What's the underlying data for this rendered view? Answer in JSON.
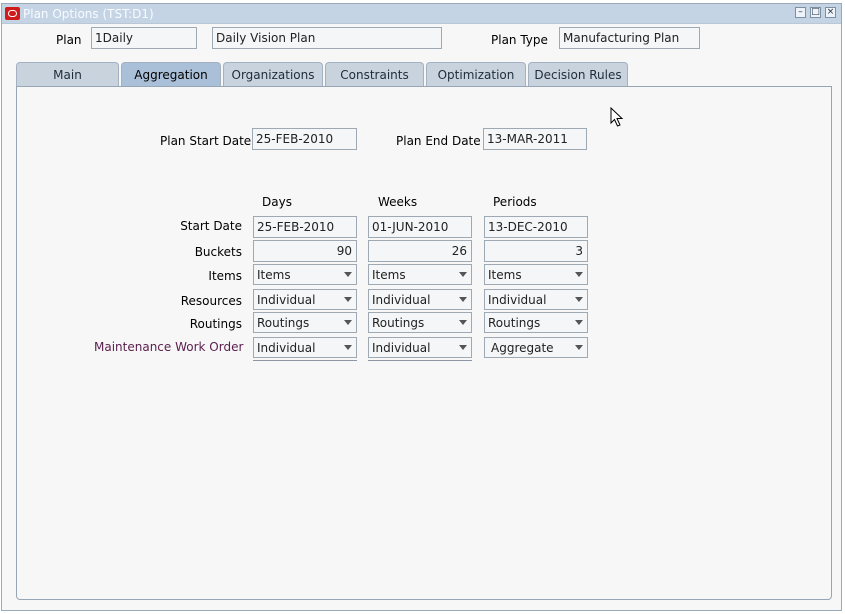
{
  "window": {
    "title": "Plan Options (TST:D1)",
    "logo_icon": "oracle-logo-icon",
    "controls": [
      "minimize-icon",
      "maximize-icon",
      "close-icon"
    ]
  },
  "header": {
    "plan_label": "Plan",
    "plan_value": "1Daily",
    "plan_description": "Daily Vision Plan",
    "plan_type_label": "Plan Type",
    "plan_type_value": "Manufacturing Plan"
  },
  "tabs": [
    {
      "label": "Main"
    },
    {
      "label": "Aggregation"
    },
    {
      "label": "Organizations"
    },
    {
      "label": "Constraints"
    },
    {
      "label": "Optimization"
    },
    {
      "label": "Decision Rules"
    }
  ],
  "active_tab": "Aggregation",
  "dates": {
    "start_label": "Plan Start Date",
    "start_value": "25-FEB-2010",
    "end_label": "Plan End Date",
    "end_value": "13-MAR-2011"
  },
  "grid": {
    "columns": [
      "Days",
      "Weeks",
      "Periods"
    ],
    "row_labels": {
      "start_date": "Start Date",
      "buckets": "Buckets",
      "items": "Items",
      "resources": "Resources",
      "routings": "Routings",
      "maintenance": "Maintenance Work Order"
    },
    "start_date": [
      "25-FEB-2010",
      "01-JUN-2010",
      "13-DEC-2010"
    ],
    "buckets": [
      "90",
      "26",
      "3"
    ],
    "items": [
      "Items",
      "Items",
      "Items"
    ],
    "resources": [
      "Individual",
      "Individual",
      "Individual"
    ],
    "routings": [
      "Routings",
      "Routings",
      "Routings"
    ],
    "maintenance": [
      "Individual",
      "Individual",
      "Aggregate"
    ]
  },
  "colors": {
    "titlebar": "#c5d4e5",
    "active_tab": "#aac0d8",
    "inactive_tab": "#c8d3de",
    "field_bg": "#f4f6f7",
    "maintenance_label": "#5a1e4d"
  }
}
